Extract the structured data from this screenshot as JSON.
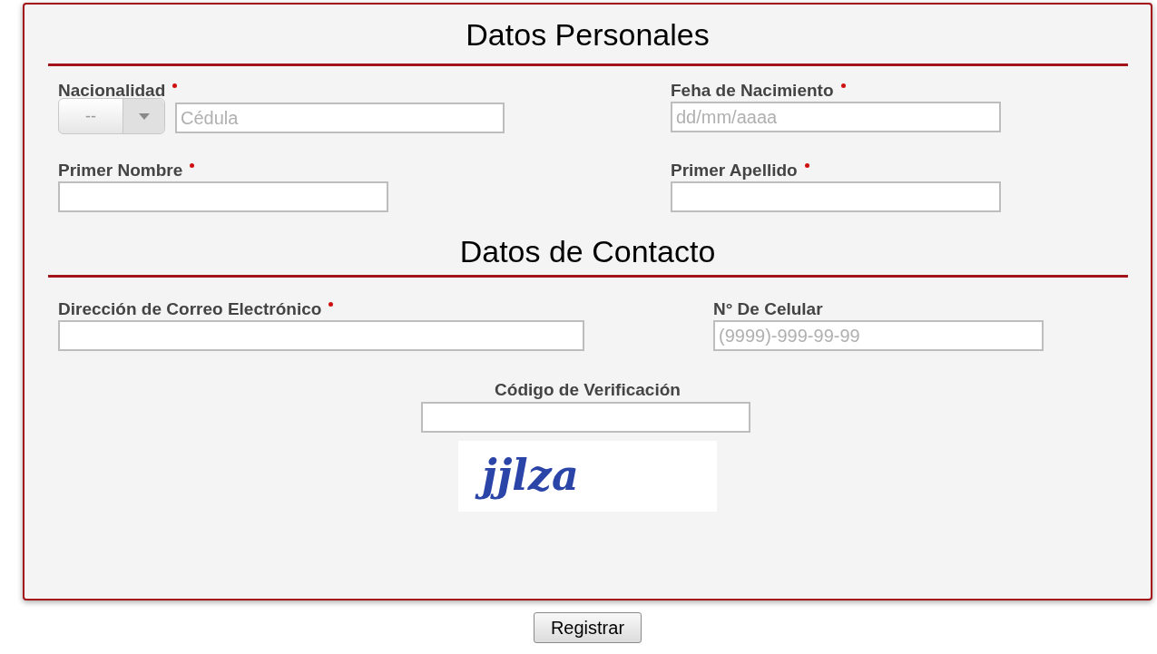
{
  "sections": [
    {
      "title": "Datos Personales",
      "kind": "personal",
      "fields": [
        {
          "kind": "select-text",
          "label": "Nacionalidad",
          "required": true,
          "select_value": "--",
          "placeholder": "Cédula"
        },
        {
          "kind": "text",
          "label": "Feha de Nacimiento",
          "required": true,
          "placeholder": "dd/mm/aaaa"
        },
        {
          "kind": "text",
          "label": "Primer Nombre",
          "required": true
        },
        {
          "kind": "text",
          "label": "Primer Apellido",
          "required": true
        }
      ]
    },
    {
      "title": "Datos de Contacto",
      "kind": "contact",
      "fields": [
        {
          "kind": "wide",
          "label": "Dirección de Correo Electrónico",
          "required": true
        },
        {
          "kind": "text",
          "label": "N° De Celular",
          "required": false,
          "placeholder": "(9999)-999-99-99"
        }
      ]
    }
  ],
  "verification": {
    "label": "Código de Verificación",
    "captcha": "jjlza"
  },
  "submit": "Registrar"
}
